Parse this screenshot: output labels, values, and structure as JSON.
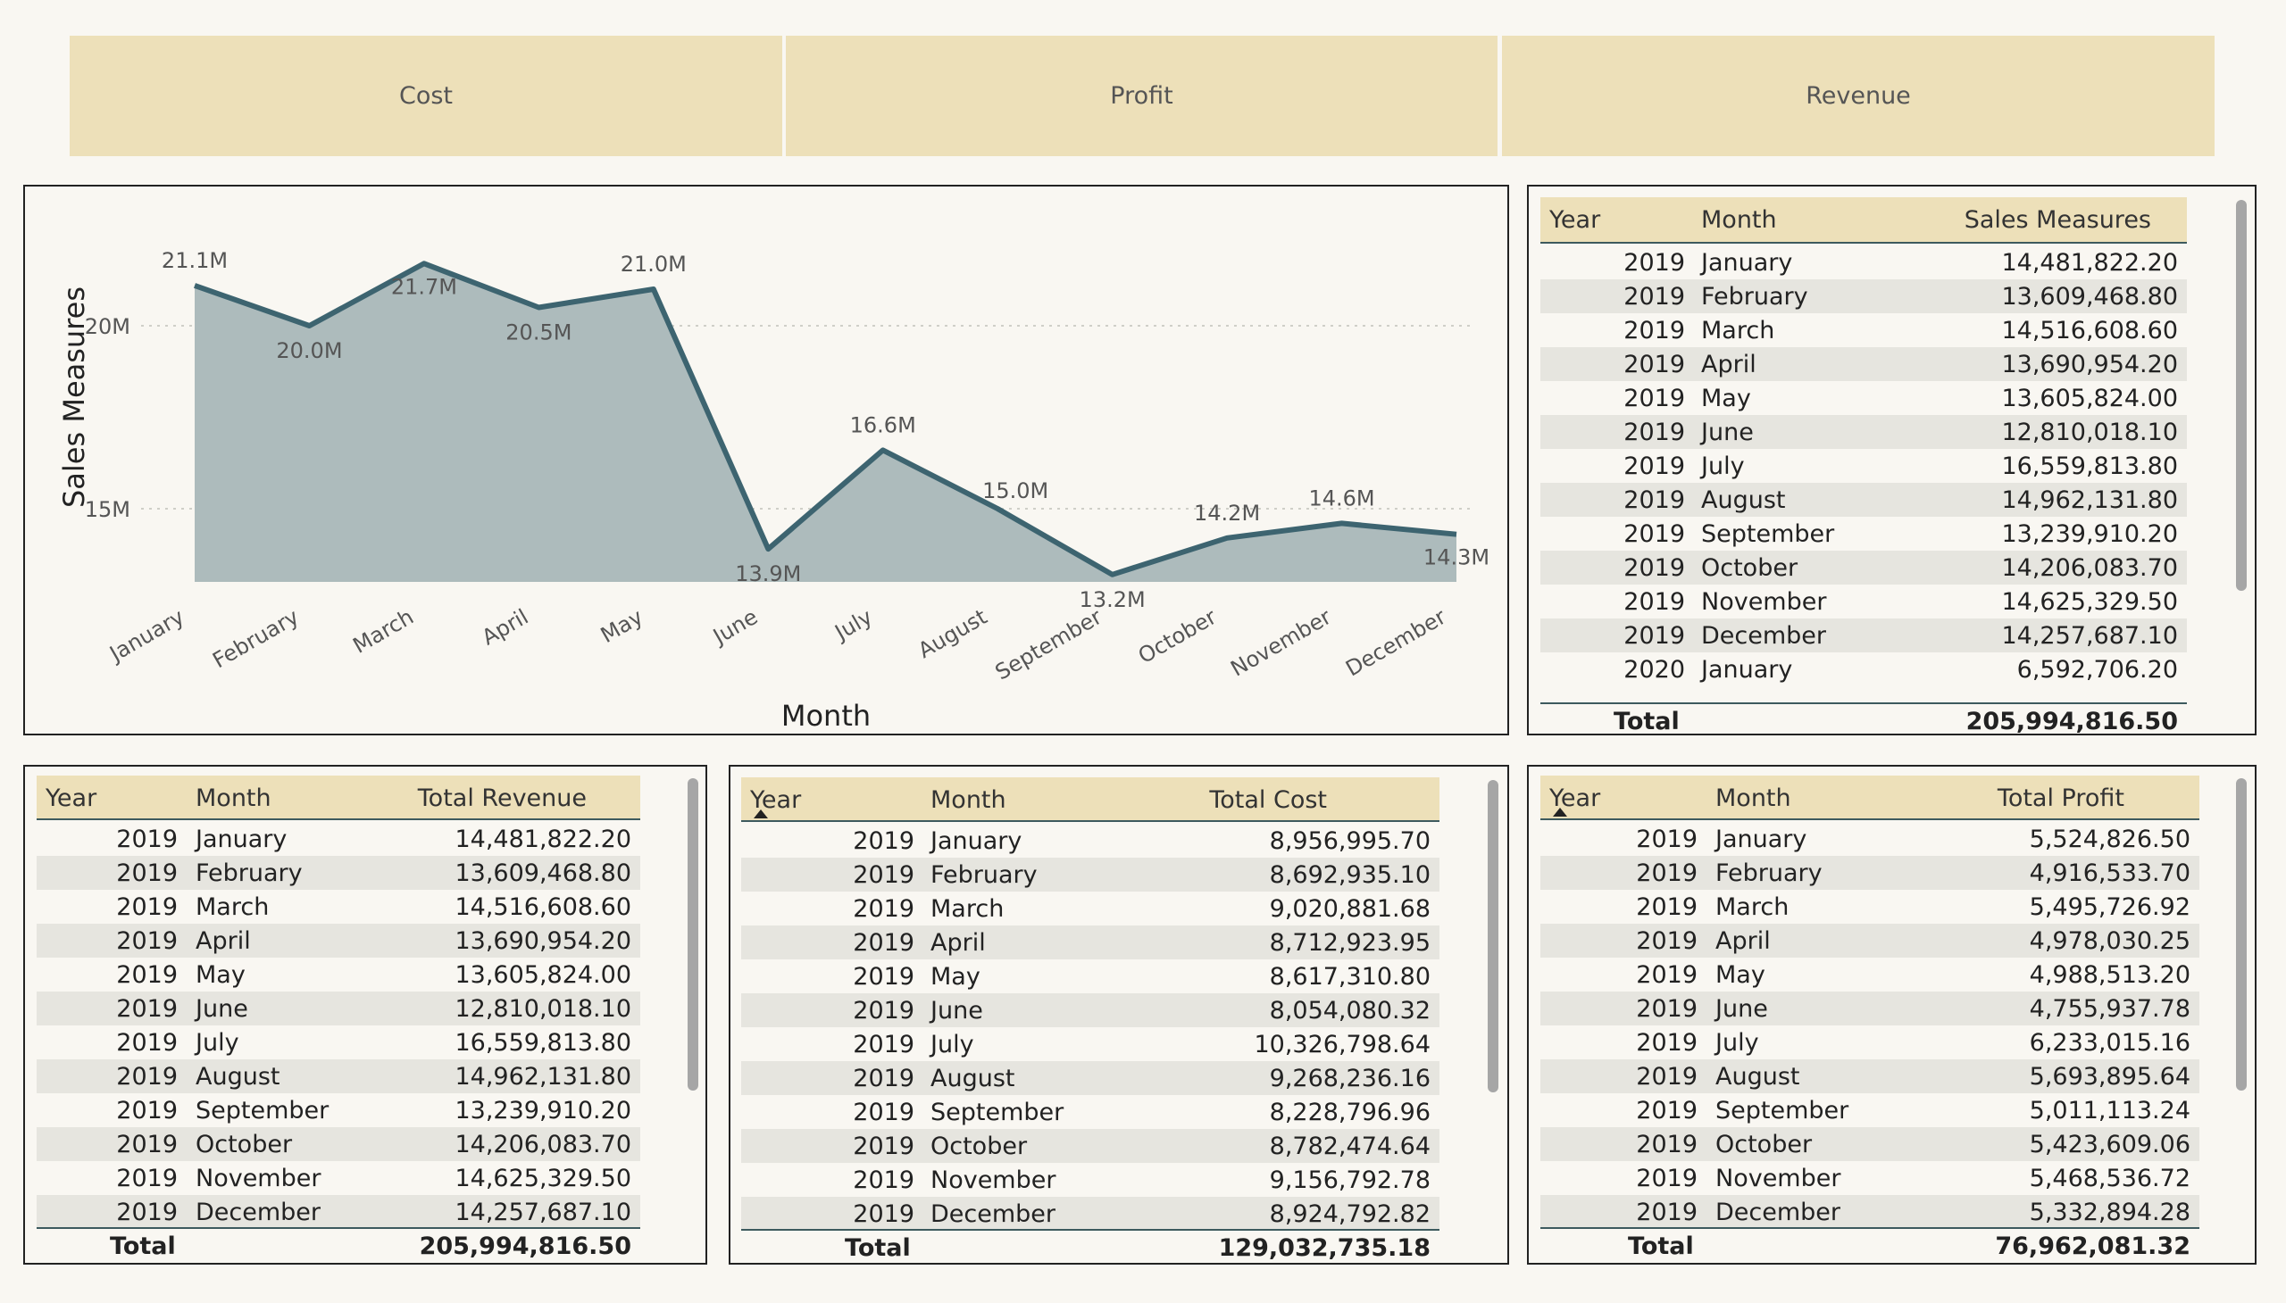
{
  "buttons": {
    "cost": "Cost",
    "profit": "Profit",
    "revenue": "Revenue"
  },
  "colors": {
    "accent": "#ede0b9",
    "line": "#3d6470",
    "area": "#adbbbc",
    "background": "#f9f7f2"
  },
  "chart_data": {
    "type": "area",
    "xlabel": "Month",
    "ylabel": "Sales Measures",
    "categories": [
      "January",
      "February",
      "March",
      "April",
      "May",
      "June",
      "July",
      "August",
      "September",
      "October",
      "November",
      "December"
    ],
    "values": [
      21.1,
      20.0,
      21.7,
      20.5,
      21.0,
      13.9,
      16.6,
      15.0,
      13.2,
      14.2,
      14.6,
      14.3
    ],
    "labels": [
      "21.1M",
      "20.0M",
      "21.7M",
      "20.5M",
      "21.0M",
      "13.9M",
      "16.6M",
      "15.0M",
      "13.2M",
      "14.2M",
      "14.6M",
      "14.3M"
    ],
    "yticks": [
      "20M",
      "15M"
    ],
    "grid": true
  },
  "sales_table": {
    "headers": [
      "Year",
      "Month",
      "Sales Measures"
    ],
    "rows": [
      [
        "2019",
        "January",
        "14,481,822.20"
      ],
      [
        "2019",
        "February",
        "13,609,468.80"
      ],
      [
        "2019",
        "March",
        "14,516,608.60"
      ],
      [
        "2019",
        "April",
        "13,690,954.20"
      ],
      [
        "2019",
        "May",
        "13,605,824.00"
      ],
      [
        "2019",
        "June",
        "12,810,018.10"
      ],
      [
        "2019",
        "July",
        "16,559,813.80"
      ],
      [
        "2019",
        "August",
        "14,962,131.80"
      ],
      [
        "2019",
        "September",
        "13,239,910.20"
      ],
      [
        "2019",
        "October",
        "14,206,083.70"
      ],
      [
        "2019",
        "November",
        "14,625,329.50"
      ],
      [
        "2019",
        "December",
        "14,257,687.10"
      ],
      [
        "2020",
        "January",
        "6,592,706.20"
      ]
    ],
    "total_label": "Total",
    "total": "205,994,816.50"
  },
  "revenue_table": {
    "headers": [
      "Year",
      "Month",
      "Total Revenue"
    ],
    "rows": [
      [
        "2019",
        "January",
        "14,481,822.20"
      ],
      [
        "2019",
        "February",
        "13,609,468.80"
      ],
      [
        "2019",
        "March",
        "14,516,608.60"
      ],
      [
        "2019",
        "April",
        "13,690,954.20"
      ],
      [
        "2019",
        "May",
        "13,605,824.00"
      ],
      [
        "2019",
        "June",
        "12,810,018.10"
      ],
      [
        "2019",
        "July",
        "16,559,813.80"
      ],
      [
        "2019",
        "August",
        "14,962,131.80"
      ],
      [
        "2019",
        "September",
        "13,239,910.20"
      ],
      [
        "2019",
        "October",
        "14,206,083.70"
      ],
      [
        "2019",
        "November",
        "14,625,329.50"
      ],
      [
        "2019",
        "December",
        "14,257,687.10"
      ]
    ],
    "total_label": "Total",
    "total": "205,994,816.50"
  },
  "cost_table": {
    "headers": [
      "Year",
      "Month",
      "Total Cost"
    ],
    "rows": [
      [
        "2019",
        "January",
        "8,956,995.70"
      ],
      [
        "2019",
        "February",
        "8,692,935.10"
      ],
      [
        "2019",
        "March",
        "9,020,881.68"
      ],
      [
        "2019",
        "April",
        "8,712,923.95"
      ],
      [
        "2019",
        "May",
        "8,617,310.80"
      ],
      [
        "2019",
        "June",
        "8,054,080.32"
      ],
      [
        "2019",
        "July",
        "10,326,798.64"
      ],
      [
        "2019",
        "August",
        "9,268,236.16"
      ],
      [
        "2019",
        "September",
        "8,228,796.96"
      ],
      [
        "2019",
        "October",
        "8,782,474.64"
      ],
      [
        "2019",
        "November",
        "9,156,792.78"
      ],
      [
        "2019",
        "December",
        "8,924,792.82"
      ]
    ],
    "total_label": "Total",
    "total": "129,032,735.18"
  },
  "profit_table": {
    "headers": [
      "Year",
      "Month",
      "Total Profit"
    ],
    "rows": [
      [
        "2019",
        "January",
        "5,524,826.50"
      ],
      [
        "2019",
        "February",
        "4,916,533.70"
      ],
      [
        "2019",
        "March",
        "5,495,726.92"
      ],
      [
        "2019",
        "April",
        "4,978,030.25"
      ],
      [
        "2019",
        "May",
        "4,988,513.20"
      ],
      [
        "2019",
        "June",
        "4,755,937.78"
      ],
      [
        "2019",
        "July",
        "6,233,015.16"
      ],
      [
        "2019",
        "August",
        "5,693,895.64"
      ],
      [
        "2019",
        "September",
        "5,011,113.24"
      ],
      [
        "2019",
        "October",
        "5,423,609.06"
      ],
      [
        "2019",
        "November",
        "5,468,536.72"
      ],
      [
        "2019",
        "December",
        "5,332,894.28"
      ]
    ],
    "total_label": "Total",
    "total": "76,962,081.32"
  }
}
